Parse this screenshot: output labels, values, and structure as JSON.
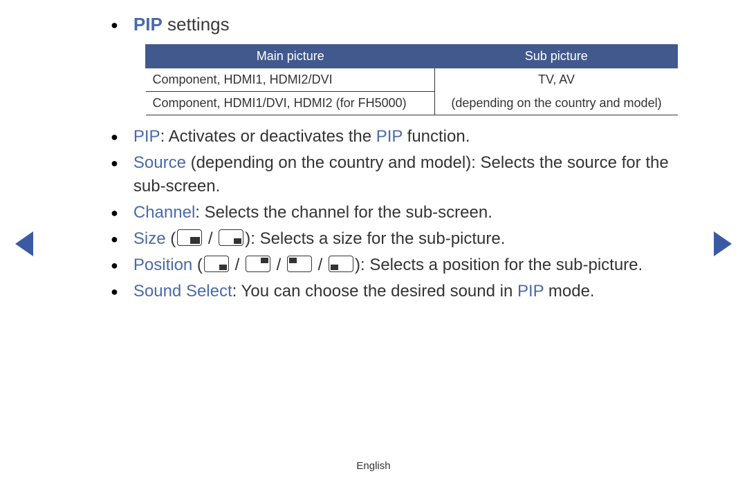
{
  "title": {
    "term": "PIP",
    "rest": " settings"
  },
  "table": {
    "headers": [
      "Main picture",
      "Sub picture"
    ],
    "main_rows": [
      "Component, HDMI1, HDMI2/DVI",
      "Component, HDMI1/DVI, HDMI2 (for FH5000)"
    ],
    "sub_rows": [
      "TV, AV",
      "(depending on the country and model)"
    ]
  },
  "items": {
    "pip": {
      "term": "PIP",
      "text": ": Activates or deactivates the ",
      "term2": "PIP",
      "tail": " function."
    },
    "source": {
      "term": "Source",
      "text": " (depending on the country and model): Selects the source for the sub-screen."
    },
    "channel": {
      "term": "Channel",
      "text": ": Selects the channel for the sub-screen."
    },
    "size": {
      "term": "Size",
      "pre": " (",
      "mid": " / ",
      "post": "): Selects a size for the sub-picture."
    },
    "position": {
      "term": "Position",
      "pre": " (",
      "sep": " / ",
      "post": "): Selects a position for the sub-picture."
    },
    "sound": {
      "term": "Sound Select",
      "text": ": You can choose the desired sound in ",
      "term2": "PIP",
      "tail": " mode."
    }
  },
  "footer": "English"
}
